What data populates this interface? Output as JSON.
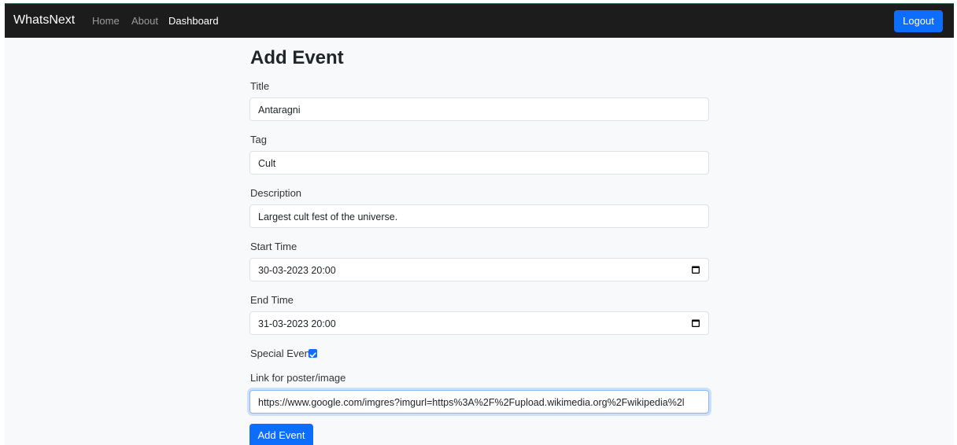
{
  "navbar": {
    "brand": "WhatsNext",
    "links": [
      {
        "label": "Home",
        "active": false
      },
      {
        "label": "About",
        "active": false
      },
      {
        "label": "Dashboard",
        "active": true
      }
    ],
    "logout_label": "Logout"
  },
  "form": {
    "heading": "Add Event",
    "title": {
      "label": "Title",
      "value": "Antaragni"
    },
    "tag": {
      "label": "Tag",
      "value": "Cult"
    },
    "description": {
      "label": "Description",
      "value": "Largest cult fest of the universe."
    },
    "start_time": {
      "label": "Start Time",
      "value": "30-03-2023 20:00",
      "icon": "calendar-icon"
    },
    "end_time": {
      "label": "End Time",
      "value": "31-03-2023 20:00",
      "icon": "calendar-icon"
    },
    "special_event": {
      "label": "Special Event",
      "checked": true
    },
    "poster_link": {
      "label": "Link for poster/image",
      "value": "https://www.google.com/imgres?imgurl=https%3A%2F%2Fupload.wikimedia.org%2Fwikipedia%2l"
    },
    "submit_label": "Add Event"
  },
  "colors": {
    "navbar_bg": "#1c1c1c",
    "primary": "#0d6efd",
    "page_bg": "#f8f9fa"
  }
}
